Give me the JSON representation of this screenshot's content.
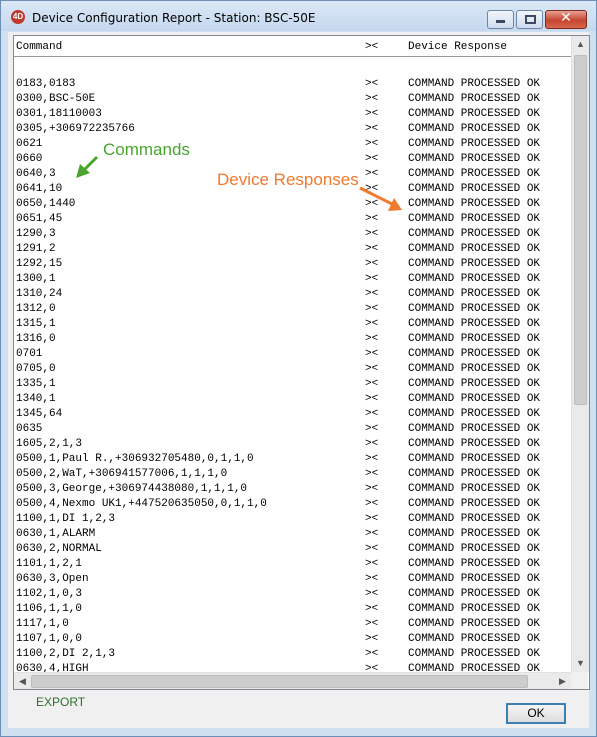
{
  "window": {
    "app_icon_label": "4D",
    "title": "Device Configuration Report  -  Station: BSC-50E",
    "minimize_glyph": "minimize",
    "maximize_glyph": "maximize",
    "close_glyph": "✕"
  },
  "table": {
    "headers": {
      "command": "Command",
      "separator": "><",
      "response": "Device Response"
    },
    "rows": [
      [
        "",
        "",
        ""
      ],
      [
        "0183,0183",
        "><",
        "COMMAND PROCESSED OK"
      ],
      [
        "0300,BSC-50E",
        "><",
        "COMMAND PROCESSED OK"
      ],
      [
        "0301,18110003",
        "><",
        "COMMAND PROCESSED OK"
      ],
      [
        "0305,+306972235766",
        "><",
        "COMMAND PROCESSED OK"
      ],
      [
        "0621",
        "><",
        "COMMAND PROCESSED OK"
      ],
      [
        "0660",
        "><",
        "COMMAND PROCESSED OK"
      ],
      [
        "0640,3",
        "><",
        "COMMAND PROCESSED OK"
      ],
      [
        "0641,10",
        "><",
        "COMMAND PROCESSED OK"
      ],
      [
        "0650,1440",
        "><",
        "COMMAND PROCESSED OK"
      ],
      [
        "0651,45",
        "><",
        "COMMAND PROCESSED OK"
      ],
      [
        "1290,3",
        "><",
        "COMMAND PROCESSED OK"
      ],
      [
        "1291,2",
        "><",
        "COMMAND PROCESSED OK"
      ],
      [
        "1292,15",
        "><",
        "COMMAND PROCESSED OK"
      ],
      [
        "1300,1",
        "><",
        "COMMAND PROCESSED OK"
      ],
      [
        "1310,24",
        "><",
        "COMMAND PROCESSED OK"
      ],
      [
        "1312,0",
        "><",
        "COMMAND PROCESSED OK"
      ],
      [
        "1315,1",
        "><",
        "COMMAND PROCESSED OK"
      ],
      [
        "1316,0",
        "><",
        "COMMAND PROCESSED OK"
      ],
      [
        "0701",
        "><",
        "COMMAND PROCESSED OK"
      ],
      [
        "0705,0",
        "><",
        "COMMAND PROCESSED OK"
      ],
      [
        "1335,1",
        "><",
        "COMMAND PROCESSED OK"
      ],
      [
        "1340,1",
        "><",
        "COMMAND PROCESSED OK"
      ],
      [
        "1345,64",
        "><",
        "COMMAND PROCESSED OK"
      ],
      [
        "0635",
        "><",
        "COMMAND PROCESSED OK"
      ],
      [
        "1605,2,1,3",
        "><",
        "COMMAND PROCESSED OK"
      ],
      [
        "0500,1,Paul R.,+306932705480,0,1,1,0",
        "><",
        "COMMAND PROCESSED OK"
      ],
      [
        "0500,2,WaT,+306941577006,1,1,1,0",
        "><",
        "COMMAND PROCESSED OK"
      ],
      [
        "0500,3,George,+306974438080,1,1,1,0",
        "><",
        "COMMAND PROCESSED OK"
      ],
      [
        "0500,4,Nexmo UK1,+447520635050,0,1,1,0",
        "><",
        "COMMAND PROCESSED OK"
      ],
      [
        "1100,1,DI 1,2,3",
        "><",
        "COMMAND PROCESSED OK"
      ],
      [
        "0630,1,ALARM",
        "><",
        "COMMAND PROCESSED OK"
      ],
      [
        "0630,2,NORMAL",
        "><",
        "COMMAND PROCESSED OK"
      ],
      [
        "1101,1,2,1",
        "><",
        "COMMAND PROCESSED OK"
      ],
      [
        "0630,3,Open",
        "><",
        "COMMAND PROCESSED OK"
      ],
      [
        "1102,1,0,3",
        "><",
        "COMMAND PROCESSED OK"
      ],
      [
        "1106,1,1,0",
        "><",
        "COMMAND PROCESSED OK"
      ],
      [
        "1117,1,0",
        "><",
        "COMMAND PROCESSED OK"
      ],
      [
        "1107,1,0,0",
        "><",
        "COMMAND PROCESSED OK"
      ],
      [
        "1100,2,DI 2,1,3",
        "><",
        "COMMAND PROCESSED OK"
      ],
      [
        "0630,4,HIGH",
        "><",
        "COMMAND PROCESSED OK"
      ]
    ]
  },
  "scrollbars": {
    "up_glyph": "▲",
    "down_glyph": "▼",
    "left_glyph": "◀",
    "right_glyph": "▶"
  },
  "annotations": {
    "commands": {
      "text": "Commands",
      "color": "#4aa52e"
    },
    "responses": {
      "text": "Device Responses",
      "color": "#f07a2d"
    }
  },
  "footer": {
    "export_label": "EXPORT",
    "ok_label": "OK"
  }
}
